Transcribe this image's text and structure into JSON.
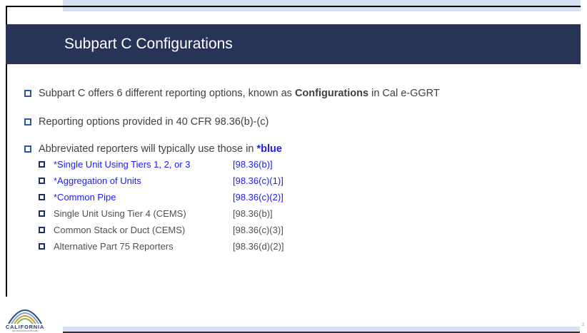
{
  "slide": {
    "title": "Subpart C Configurations",
    "page_number": "2"
  },
  "bullets": [
    {
      "text_before": "Subpart C offers 6 different reporting options, known as ",
      "bold": "Configurations",
      "text_after": " in Cal e-GGRT"
    },
    {
      "text": "Reporting options provided in 40 CFR 98.36(b)-(c)"
    },
    {
      "text": "Abbreviated reporters will typically use those in ",
      "accent": "*blue"
    }
  ],
  "sub_items": [
    {
      "name": "*Single Unit Using Tiers 1, 2, or 3",
      "ref": "[98.36(b)]",
      "color": "#1a1aff"
    },
    {
      "name": "*Aggregation of Units",
      "ref": "[98.36(c)(1)]",
      "color": "#1a1aff"
    },
    {
      "name": "*Common Pipe",
      "ref": "[98.36(c)(2)]",
      "color": "#1a1aff"
    },
    {
      "name": "Single Unit Using Tier 4 (CEMS)",
      "ref": "[98.36(b)]",
      "color": "#505050"
    },
    {
      "name": "Common Stack or Duct (CEMS)",
      "ref": "[98.36(c)(3)]",
      "color": "#505050"
    },
    {
      "name": "Alternative Part 75 Reporters",
      "ref": "[98.36(d)(2)]",
      "color": "#505050"
    }
  ],
  "logo": {
    "name": "CALIFORNIA",
    "subtitle": "AIR RESOURCES BOARD"
  },
  "colors": {
    "title_bar": "#283457",
    "accent_blue": "#1a1aff",
    "bullet_blue": "#2d57a4",
    "band": "#d5e0f2"
  }
}
